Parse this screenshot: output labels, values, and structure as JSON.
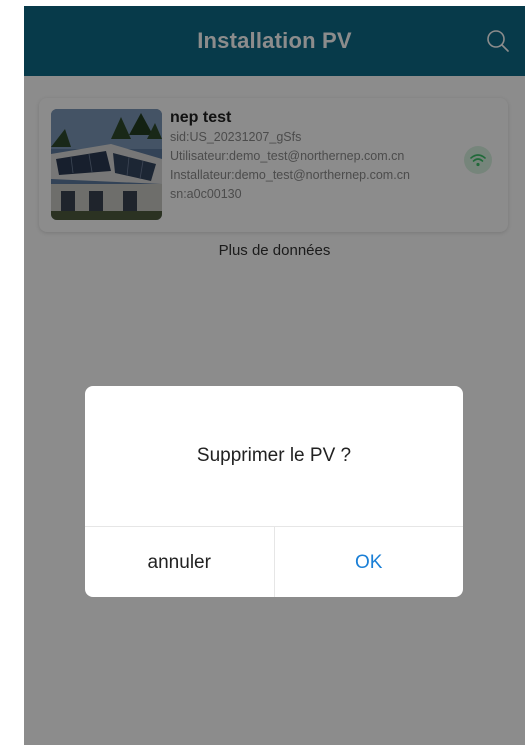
{
  "header": {
    "title": "Installation PV",
    "search_icon": "search-icon"
  },
  "plant": {
    "name": "nep test",
    "sid": "sid:US_20231207_gSfs",
    "user": "Utilisateur:demo_test@northernep.com.cn",
    "installer": "Installateur:demo_test@northernep.com.cn",
    "sn": "sn:a0c00130",
    "status_icon": "wifi-icon"
  },
  "more_label": "Plus de données",
  "dialog": {
    "message": "Supprimer le PV ?",
    "cancel_label": "annuler",
    "ok_label": "OK"
  },
  "colors": {
    "header_bg": "#0d6b87",
    "ok_blue": "#1a7fd6",
    "wifi_green": "#3cc26a"
  }
}
